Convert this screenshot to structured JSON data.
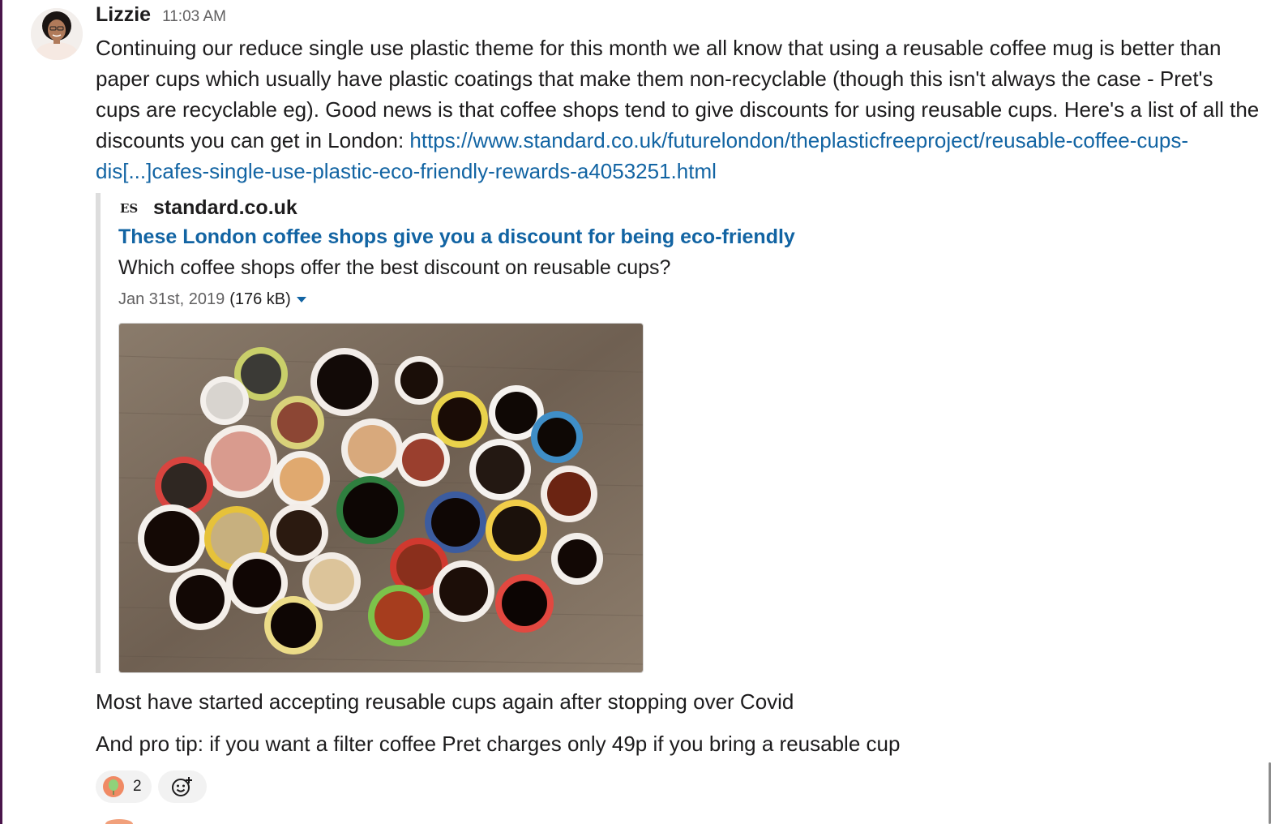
{
  "message": {
    "author": "Lizzie",
    "time": "11:03 AM",
    "body_text": "Continuing our reduce single use plastic theme for this month we all know that using a reusable coffee mug is better than paper cups which usually have plastic coatings that make them non-recyclable (though this isn't always the case - Pret's cups are recyclable eg). Good news is that coffee shops tend to give discounts for using reusable cups. Here's a list of all the discounts you can get in London: ",
    "link_text": "https://www.standard.co.uk/futurelondon/theplasticfreeproject/reusable-coffee-cups-dis[...]cafes-single-use-plastic-eco-friendly-rewards-a4053251.html",
    "followup_1": "Most have started accepting reusable cups again after stopping over Covid",
    "followup_2": "And pro tip: if you want a filter coffee Pret charges only 49p if you bring a reusable cup"
  },
  "unfurl": {
    "logo_text": "ES",
    "site_name": "standard.co.uk",
    "title": "These London coffee shops give you a discount for being eco-friendly",
    "description": "Which coffee shops offer the best discount on reusable cups?",
    "date": "Jan 31st, 2019",
    "size": "(176 kB)",
    "image_icon": "coffee-cups-photo"
  },
  "reactions": [
    {
      "emoji_icon": "balloon-emoji-icon",
      "count": "2"
    }
  ],
  "add_reaction_icon": "add-reaction-icon",
  "colors": {
    "link": "#1264a3",
    "text": "#1d1c1d",
    "muted": "#616061",
    "sidebar_edge": "#4a154b",
    "quote_bar": "#dddddd",
    "reaction_bg": "#f2f2f2"
  }
}
